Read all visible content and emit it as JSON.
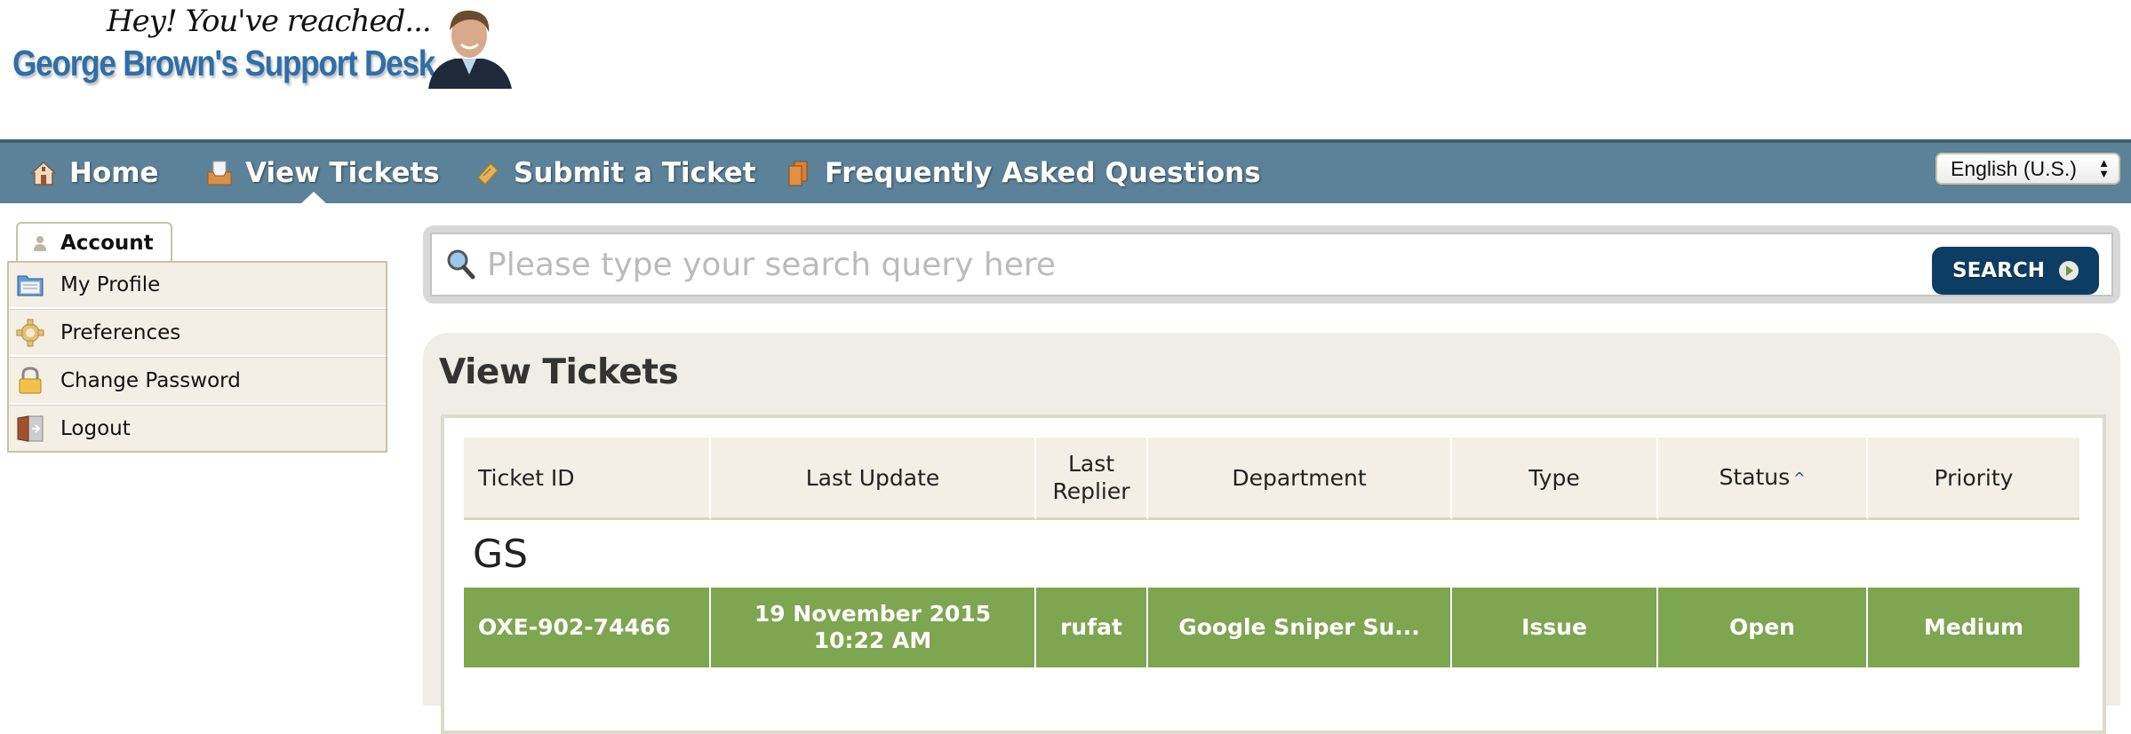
{
  "header": {
    "logo_tagline": "Hey! You've reached...",
    "logo_title": "George Brown's Support Desk"
  },
  "nav": {
    "items": [
      {
        "label": "Home",
        "icon": "house-icon"
      },
      {
        "label": "View Tickets",
        "icon": "inbox-tray-icon",
        "active": true
      },
      {
        "label": "Submit a Ticket",
        "icon": "ticket-icon"
      },
      {
        "label": "Frequently Asked Questions",
        "icon": "books-icon"
      }
    ],
    "language": "English (U.S.)"
  },
  "sidebar": {
    "tab_label": "Account",
    "items": [
      {
        "label": "My Profile",
        "icon": "profile-folder-icon"
      },
      {
        "label": "Preferences",
        "icon": "gear-icon"
      },
      {
        "label": "Change Password",
        "icon": "padlock-icon"
      },
      {
        "label": "Logout",
        "icon": "door-icon"
      }
    ]
  },
  "search": {
    "placeholder": "Please type your search query here",
    "value": "",
    "button_label": "SEARCH"
  },
  "main": {
    "title": "View Tickets",
    "table": {
      "columns": [
        "Ticket ID",
        "Last Update",
        "Last Replier",
        "Department",
        "Type",
        "Status",
        "Priority"
      ],
      "column_lines": {
        "last_replier_1": "Last",
        "last_replier_2": "Replier"
      },
      "sorted_by": "Status",
      "sort_direction": "ascending",
      "groups": [
        {
          "name": "GS",
          "rows": [
            {
              "ticket_id": "OXE-902-74466",
              "last_update_date": "19 November 2015",
              "last_update_time": "10:22 AM",
              "last_replier": "rufat",
              "department": "Google Sniper Su...",
              "type": "Issue",
              "status": "Open",
              "priority": "Medium",
              "row_color": "#7ea550"
            }
          ]
        }
      ]
    }
  }
}
